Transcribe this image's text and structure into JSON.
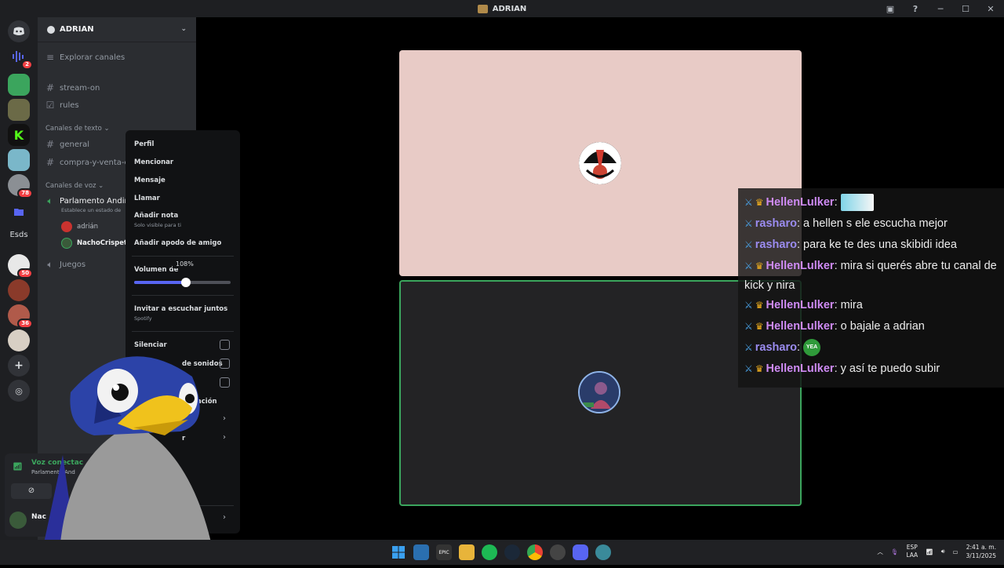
{
  "window": {
    "title": "ADRIAN"
  },
  "server_rail": {
    "badges": [
      "2",
      "78",
      "50",
      "36"
    ],
    "text_server": "Esds"
  },
  "sidebar": {
    "guild_name": "ADRIAN",
    "explore": "Explorar canales",
    "channels_top": [
      "stream-on",
      "rules"
    ],
    "text_category": "Canales de texto",
    "text_channels": [
      "general",
      "compra-y-venta-c"
    ],
    "voice_category": "Canales de voz",
    "voice_channel": "Parlamento Andin",
    "voice_status_hint": "Establece un estado de",
    "voice_users": [
      "adrián",
      "NachoCrispeta"
    ],
    "other_voice": "Juegos",
    "voice_connected": "Voz conectac",
    "voice_connected_sub": "Parlamento And",
    "user_short": "Nac"
  },
  "context_menu": {
    "profile": "Perfil",
    "mention": "Mencionar",
    "message": "Mensaje",
    "call": "Llamar",
    "add_note": "Añadir nota",
    "add_note_sub": "Solo visible para ti",
    "friend_nickname": "Añadir apodo de amigo",
    "volume_label": "Volumen de",
    "volume_value": "108%",
    "volume_fraction": 0.54,
    "listen_together": "Invitar a escuchar juntos",
    "listen_together_sub": "Spotify",
    "mute": "Silenciar",
    "soundboard_partial": "de sonidos",
    "notification_partial": "ación",
    "more_partial": "r"
  },
  "chat_overlay": {
    "messages": [
      {
        "user": "HellenLulker",
        "type": "h",
        "text": "",
        "emote": "wide"
      },
      {
        "user": "rasharo",
        "type": "r",
        "text": "a hellen s ele escucha mejor"
      },
      {
        "user": "rasharo",
        "type": "r",
        "text": "para ke te des una skibidi idea"
      },
      {
        "user": "HellenLulker",
        "type": "h",
        "text": "mira si querés abre tu canal de kick y nira"
      },
      {
        "user": "HellenLulker",
        "type": "h",
        "text": "mira"
      },
      {
        "user": "HellenLulker",
        "type": "h",
        "text": "o bajale a adrian"
      },
      {
        "user": "rasharo",
        "type": "r",
        "text": "",
        "emote": "YEA"
      },
      {
        "user": "HellenLulker",
        "type": "h",
        "text": "y así te puedo subir"
      }
    ]
  },
  "taskbar": {
    "lang_top": "ESP",
    "lang_bottom": "LAA",
    "time": "2:41 a. m.",
    "date": "3/11/2025"
  }
}
